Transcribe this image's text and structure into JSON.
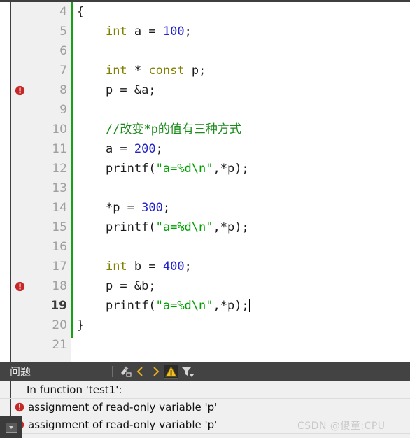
{
  "editor": {
    "gutter_green_bar_color": "#16a016",
    "error_marker_color": "#c62828",
    "lines": [
      {
        "number": "4",
        "marker": false,
        "current": false,
        "tokens": [
          {
            "t": "{",
            "c": "pl"
          }
        ],
        "indent": 0
      },
      {
        "number": "5",
        "marker": false,
        "current": false,
        "tokens": [
          {
            "t": "int",
            "c": "kw"
          },
          {
            "t": " a = ",
            "c": "pl"
          },
          {
            "t": "100",
            "c": "num"
          },
          {
            "t": ";",
            "c": "pl"
          }
        ],
        "indent": 1
      },
      {
        "number": "6",
        "marker": false,
        "current": false,
        "tokens": [],
        "indent": 0
      },
      {
        "number": "7",
        "marker": false,
        "current": false,
        "tokens": [
          {
            "t": "int",
            "c": "kw"
          },
          {
            "t": " * ",
            "c": "pl"
          },
          {
            "t": "const",
            "c": "kw"
          },
          {
            "t": " p;",
            "c": "pl"
          }
        ],
        "indent": 1
      },
      {
        "number": "8",
        "marker": true,
        "current": false,
        "tokens": [
          {
            "t": "p = &a;",
            "c": "pl"
          }
        ],
        "indent": 1
      },
      {
        "number": "9",
        "marker": false,
        "current": false,
        "tokens": [],
        "indent": 0
      },
      {
        "number": "10",
        "marker": false,
        "current": false,
        "tokens": [
          {
            "t": "//改变*p的值有三种方式",
            "c": "cmt"
          }
        ],
        "indent": 1
      },
      {
        "number": "11",
        "marker": false,
        "current": false,
        "tokens": [
          {
            "t": "a = ",
            "c": "pl"
          },
          {
            "t": "200",
            "c": "num"
          },
          {
            "t": ";",
            "c": "pl"
          }
        ],
        "indent": 1
      },
      {
        "number": "12",
        "marker": false,
        "current": false,
        "tokens": [
          {
            "t": "printf(",
            "c": "pl"
          },
          {
            "t": "\"a=%d\\n\"",
            "c": "str"
          },
          {
            "t": ",*p);",
            "c": "pl"
          }
        ],
        "indent": 1
      },
      {
        "number": "13",
        "marker": false,
        "current": false,
        "tokens": [],
        "indent": 0
      },
      {
        "number": "14",
        "marker": false,
        "current": false,
        "tokens": [
          {
            "t": "*p = ",
            "c": "pl"
          },
          {
            "t": "300",
            "c": "num"
          },
          {
            "t": ";",
            "c": "pl"
          }
        ],
        "indent": 1
      },
      {
        "number": "15",
        "marker": false,
        "current": false,
        "tokens": [
          {
            "t": "printf(",
            "c": "pl"
          },
          {
            "t": "\"a=%d\\n\"",
            "c": "str"
          },
          {
            "t": ",*p);",
            "c": "pl"
          }
        ],
        "indent": 1
      },
      {
        "number": "16",
        "marker": false,
        "current": false,
        "tokens": [],
        "indent": 0
      },
      {
        "number": "17",
        "marker": false,
        "current": false,
        "tokens": [
          {
            "t": "int",
            "c": "kw"
          },
          {
            "t": " b = ",
            "c": "pl"
          },
          {
            "t": "400",
            "c": "num"
          },
          {
            "t": ";",
            "c": "pl"
          }
        ],
        "indent": 1
      },
      {
        "number": "18",
        "marker": true,
        "current": false,
        "tokens": [
          {
            "t": "p = &b;",
            "c": "pl"
          }
        ],
        "indent": 1
      },
      {
        "number": "19",
        "marker": false,
        "current": true,
        "caret": true,
        "tokens": [
          {
            "t": "printf(",
            "c": "pl"
          },
          {
            "t": "\"a=%d\\n\"",
            "c": "str"
          },
          {
            "t": ",*p);",
            "c": "pl"
          }
        ],
        "indent": 1
      },
      {
        "number": "20",
        "marker": false,
        "current": false,
        "tokens": [
          {
            "t": "}",
            "c": "pl"
          }
        ],
        "indent": 0
      },
      {
        "number": "21",
        "marker": false,
        "current": false,
        "tokens": [],
        "indent": 0
      }
    ]
  },
  "panel": {
    "title": "问题",
    "toolbar": [
      {
        "name": "clear-icon",
        "label": "clear"
      },
      {
        "name": "previous-icon",
        "label": "<"
      },
      {
        "name": "next-icon",
        "label": ">"
      },
      {
        "name": "warning-icon",
        "label": "warnings",
        "selected": true
      },
      {
        "name": "filter-icon",
        "label": "filter"
      }
    ],
    "rows": [
      {
        "kind": "header",
        "icon": false,
        "text": "In function 'test1':"
      },
      {
        "kind": "error",
        "icon": true,
        "text": "assignment of read-only variable 'p'"
      },
      {
        "kind": "error",
        "icon": true,
        "text": "assignment of read-only variable 'p'"
      }
    ]
  },
  "watermark": {
    "text": "CSDN @傻童:CPU"
  }
}
